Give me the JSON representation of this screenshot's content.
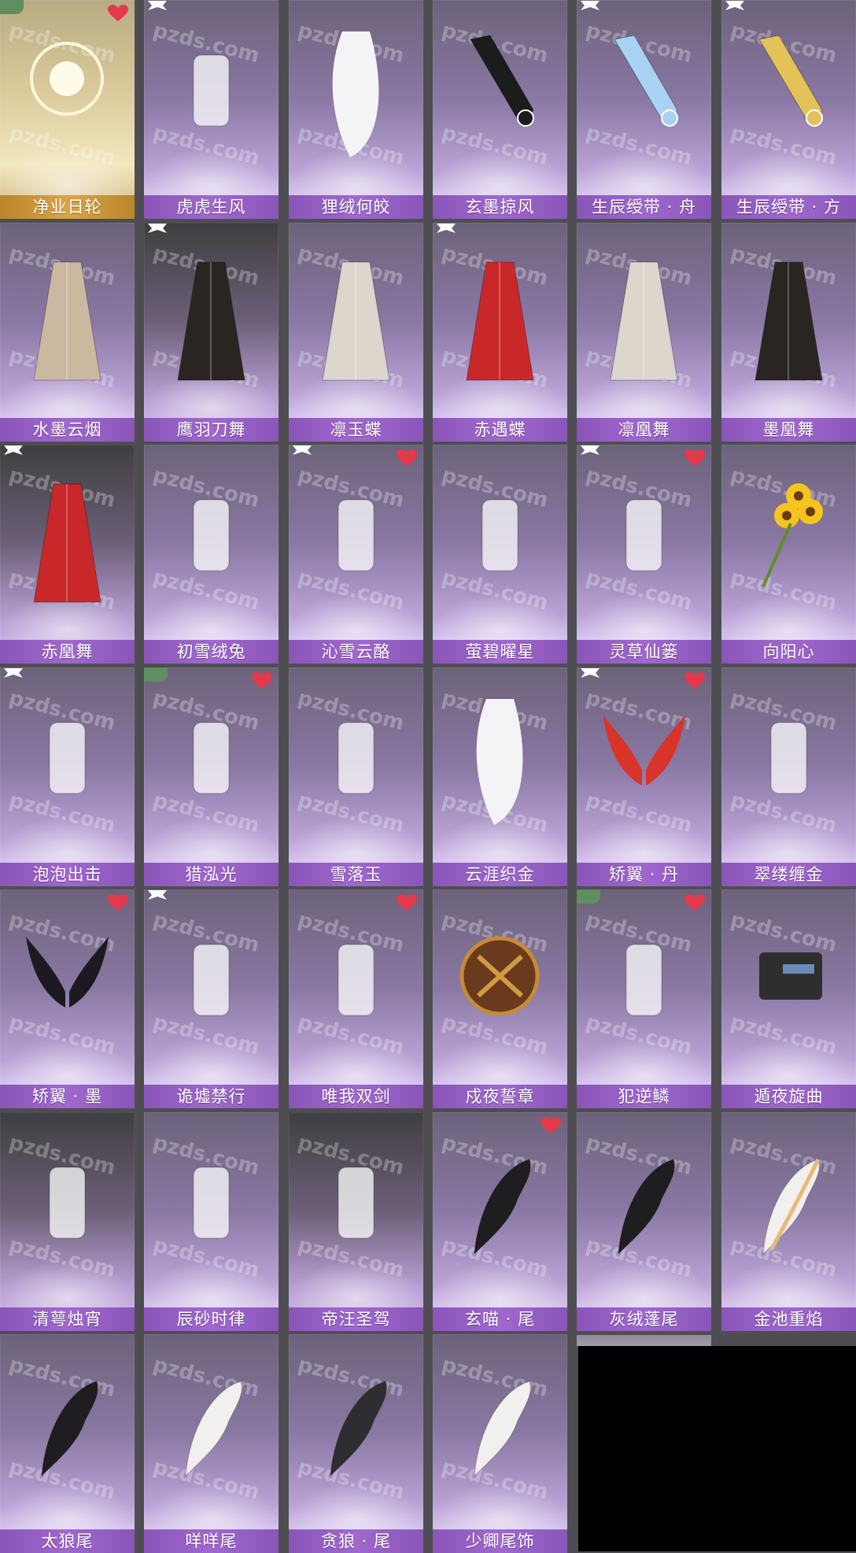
{
  "watermark": "pzds.com",
  "colors": {
    "label_bg": "#9a62c6",
    "label_gold_bg": "#d19d3e",
    "heart": "#e5384a",
    "tag_green": "#5f8e5f"
  },
  "items": [
    {
      "name": "净业日轮",
      "style": "gold",
      "art": "orb-icon",
      "heart": true,
      "tag": "green"
    },
    {
      "name": "虎虎生风",
      "style": "normal",
      "art": "tiger-sweater-icon",
      "heart": false,
      "tag": "corner"
    },
    {
      "name": "狸绒何皎",
      "style": "normal",
      "art": "white-hair-icon",
      "heart": false,
      "tag": ""
    },
    {
      "name": "玄墨掠风",
      "style": "normal",
      "art": "black-scarf-icon",
      "heart": false,
      "tag": ""
    },
    {
      "name": "生辰绶带 · 舟",
      "style": "normal",
      "art": "blue-sash-icon",
      "heart": false,
      "tag": "corner"
    },
    {
      "name": "生辰绶带 · 方",
      "style": "normal",
      "art": "gold-sash-icon",
      "heart": false,
      "tag": "corner"
    },
    {
      "name": "水墨云烟",
      "style": "normal",
      "art": "ink-robe-icon",
      "heart": false,
      "tag": ""
    },
    {
      "name": "鹰羽刀舞",
      "style": "dark",
      "art": "black-cape-icon",
      "heart": false,
      "tag": "corner"
    },
    {
      "name": "凛玉蝶",
      "style": "normal",
      "art": "white-butterfly-icon",
      "heart": false,
      "tag": ""
    },
    {
      "name": "赤遇蝶",
      "style": "normal",
      "art": "red-butterfly-icon",
      "heart": false,
      "tag": "corner"
    },
    {
      "name": "凛凰舞",
      "style": "normal",
      "art": "white-feather-cape-icon",
      "heart": false,
      "tag": ""
    },
    {
      "name": "墨凰舞",
      "style": "normal",
      "art": "dark-feather-cape-icon",
      "heart": false,
      "tag": ""
    },
    {
      "name": "赤凰舞",
      "style": "dark",
      "art": "red-cape-icon",
      "heart": false,
      "tag": "corner"
    },
    {
      "name": "初雪绒兔",
      "style": "normal",
      "art": "white-rabbit-icon",
      "heart": false,
      "tag": ""
    },
    {
      "name": "沁雪云酪",
      "style": "normal",
      "art": "ice-cream-icon",
      "heart": true,
      "tag": "corner"
    },
    {
      "name": "萤碧曜星",
      "style": "normal",
      "art": "star-wand-icon",
      "heart": false,
      "tag": ""
    },
    {
      "name": "灵草仙篓",
      "style": "normal",
      "art": "herb-basket-icon",
      "heart": true,
      "tag": "corner"
    },
    {
      "name": "向阳心",
      "style": "normal",
      "art": "sunflower-icon",
      "heart": false,
      "tag": ""
    },
    {
      "name": "泡泡出击",
      "style": "normal",
      "art": "bubble-gun-icon",
      "heart": false,
      "tag": "corner"
    },
    {
      "name": "猎泓光",
      "style": "normal",
      "art": "light-wisp-icon",
      "heart": true,
      "tag": "green"
    },
    {
      "name": "雪落玉",
      "style": "normal",
      "art": "flute-icon",
      "heart": false,
      "tag": ""
    },
    {
      "name": "云涯织金",
      "style": "normal",
      "art": "hair-ornament-icon",
      "heart": false,
      "tag": ""
    },
    {
      "name": "矫翼 · 丹",
      "style": "normal",
      "art": "red-wings-icon",
      "heart": true,
      "tag": "corner"
    },
    {
      "name": "翠缕缠金",
      "style": "normal",
      "art": "tassel-icon",
      "heart": false,
      "tag": ""
    },
    {
      "name": "矫翼 · 墨",
      "style": "normal",
      "art": "black-wings-icon",
      "heart": true,
      "tag": ""
    },
    {
      "name": "诡墟禁行",
      "style": "normal",
      "art": "red-lantern-icon",
      "heart": false,
      "tag": "corner"
    },
    {
      "name": "唯我双剑",
      "style": "normal",
      "art": "twin-swords-icon",
      "heart": true,
      "tag": ""
    },
    {
      "name": "戍夜誓章",
      "style": "normal",
      "art": "emblem-icon",
      "heart": false,
      "tag": ""
    },
    {
      "name": "犯逆鳞",
      "style": "normal",
      "art": "silver-necklace-icon",
      "heart": true,
      "tag": "green"
    },
    {
      "name": "遁夜旋曲",
      "style": "normal",
      "art": "radio-icon",
      "heart": false,
      "tag": ""
    },
    {
      "name": "清萼烛宵",
      "style": "dark",
      "art": "lotus-ring-icon",
      "heart": false,
      "tag": ""
    },
    {
      "name": "辰砂时律",
      "style": "normal",
      "art": "hourglass-icon",
      "heart": false,
      "tag": ""
    },
    {
      "name": "帝汪圣驾",
      "style": "dark",
      "art": "fox-pendant-icon",
      "heart": false,
      "tag": ""
    },
    {
      "name": "玄喵 · 尾",
      "style": "normal",
      "art": "cat-tail-icon",
      "heart": true,
      "tag": ""
    },
    {
      "name": "灰绒蓬尾",
      "style": "normal",
      "art": "fluffy-tail-icon",
      "heart": false,
      "tag": ""
    },
    {
      "name": "金池重焰",
      "style": "normal",
      "art": "cream-tail-icon",
      "heart": false,
      "tag": ""
    },
    {
      "name": "太狼尾",
      "style": "normal",
      "art": "wolf-tail-icon",
      "heart": false,
      "tag": ""
    },
    {
      "name": "咩咩尾",
      "style": "normal",
      "art": "white-tail-icon",
      "heart": false,
      "tag": ""
    },
    {
      "name": "贪狼 · 尾",
      "style": "normal",
      "art": "grey-tail-icon",
      "heart": false,
      "tag": ""
    },
    {
      "name": "少卿尾饰",
      "style": "normal",
      "art": "long-white-tail-icon",
      "heart": false,
      "tag": ""
    }
  ]
}
